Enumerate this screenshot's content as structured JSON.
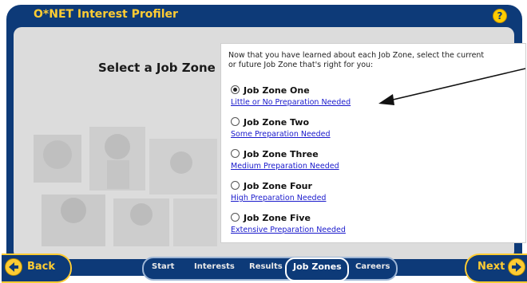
{
  "app": {
    "title": "O*NET Interest Profiler",
    "help_icon": "?"
  },
  "main": {
    "heading": "Select a Job Zone",
    "intro": "Now that you have learned about each Job Zone, select the current or future Job Zone that's right for you:",
    "options": [
      {
        "label": "Job Zone One",
        "link": "Little or No Preparation Needed",
        "checked": true
      },
      {
        "label": "Job Zone Two",
        "link": "Some Preparation Needed",
        "checked": false
      },
      {
        "label": "Job Zone Three",
        "link": "Medium Preparation Needed",
        "checked": false
      },
      {
        "label": "Job Zone Four",
        "link": "High Preparation Needed",
        "checked": false
      },
      {
        "label": "Job Zone Five",
        "link": "Extensive Preparation Needed",
        "checked": false
      }
    ]
  },
  "nav": {
    "back": "Back",
    "next": "Next",
    "tabs": [
      "Start",
      "Interests",
      "Results",
      "Job Zones",
      "Careers"
    ],
    "active_tab": "Job Zones"
  },
  "colors": {
    "frame": "#0d3a78",
    "accent": "#ffcc33",
    "link": "#1a1acc"
  }
}
